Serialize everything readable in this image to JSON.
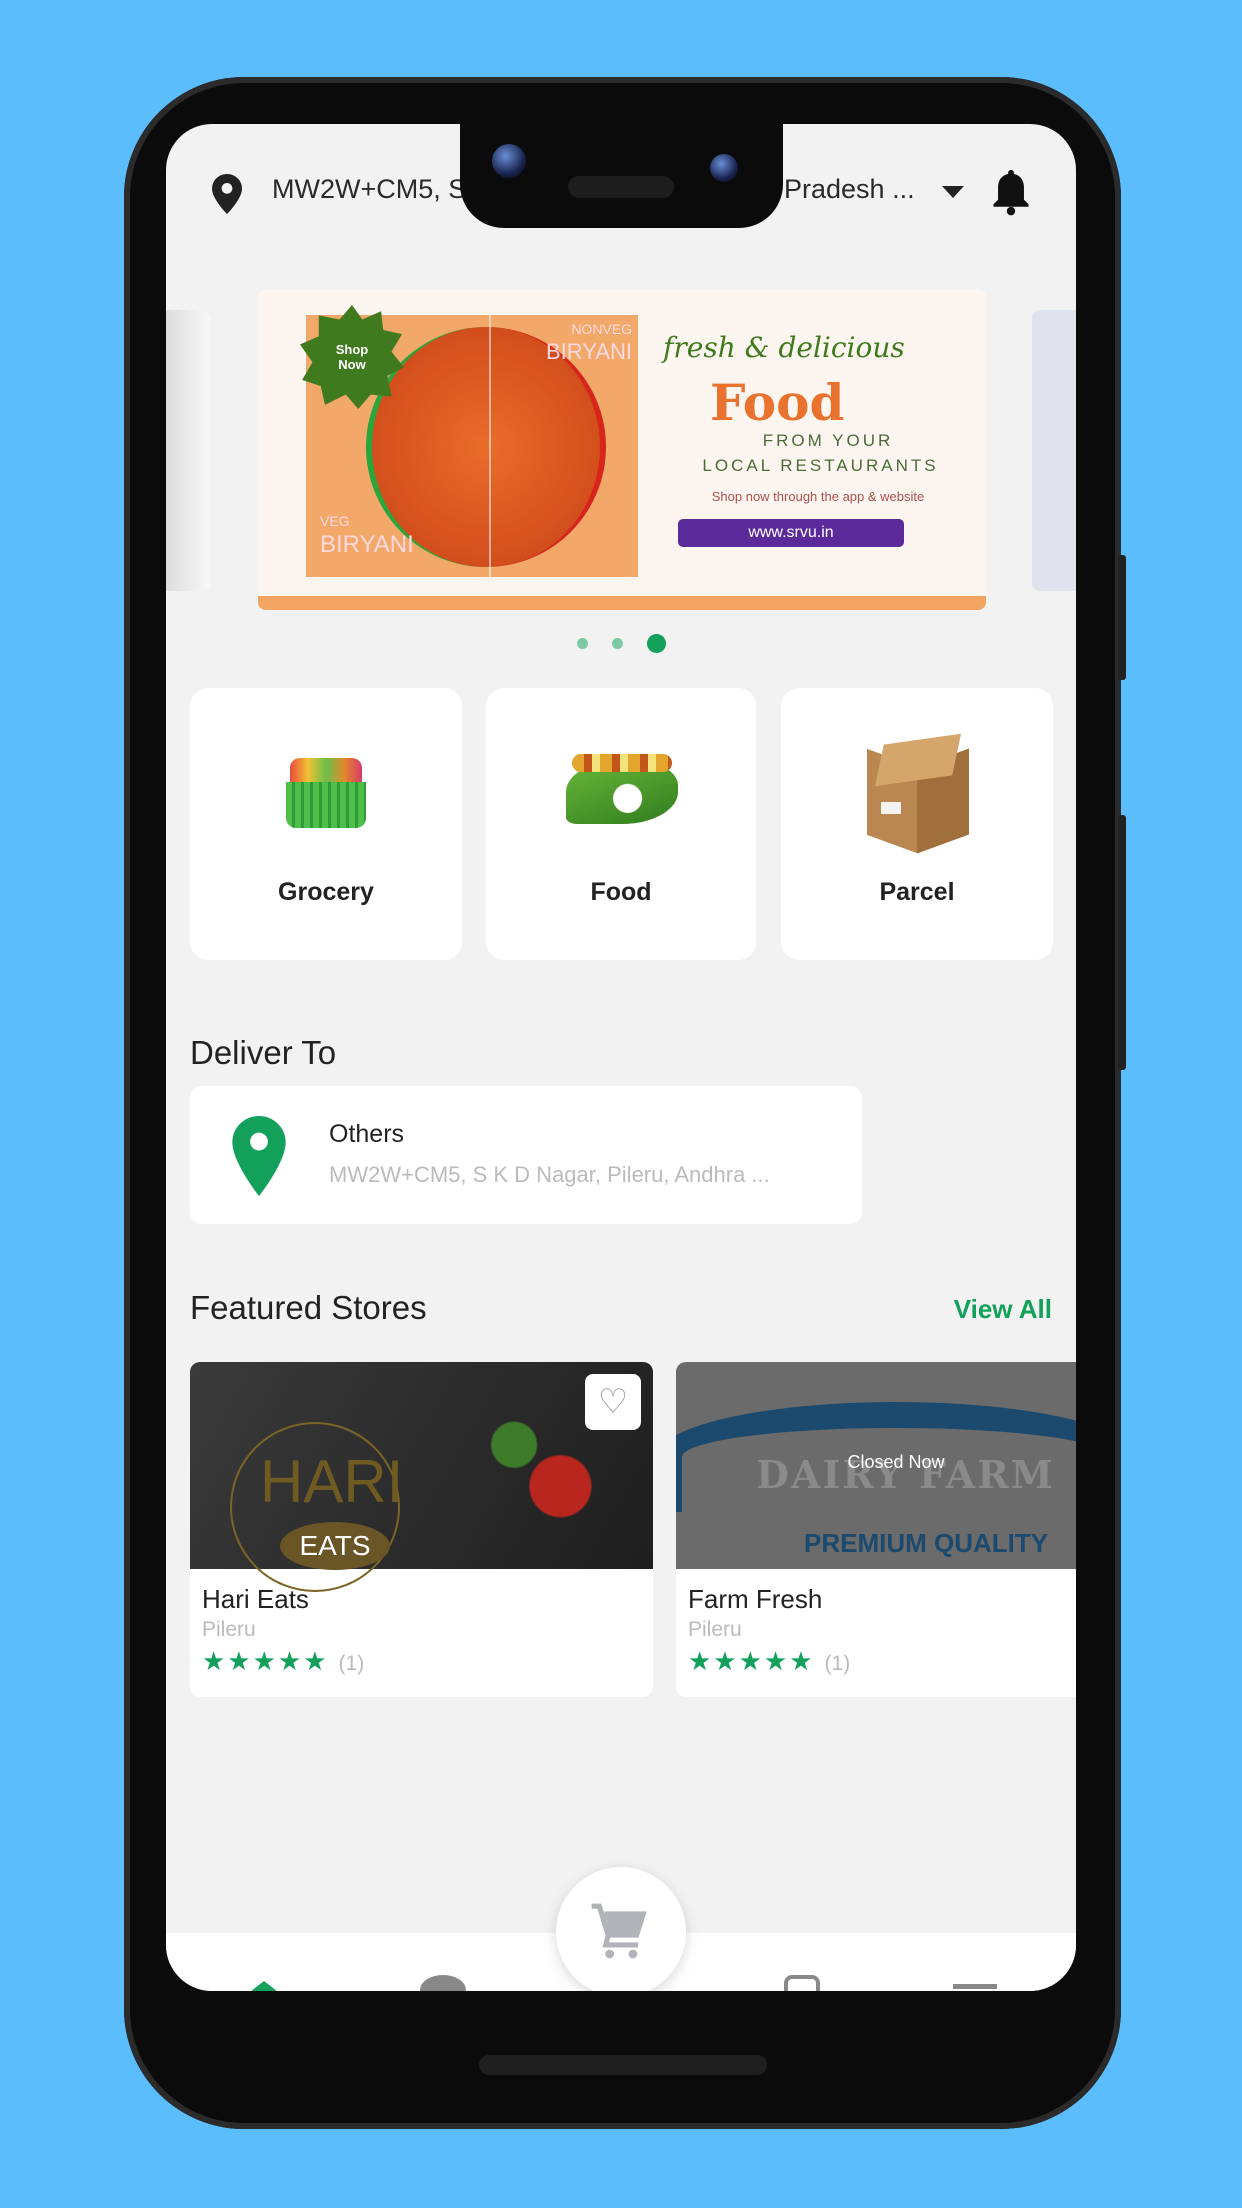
{
  "header": {
    "location_left": "MW2W+CM5, S",
    "location_right": "Pradesh ...",
    "icons": [
      "map-pin-icon",
      "dropdown-triangle-icon",
      "bell-icon"
    ]
  },
  "banner": {
    "badge": "Shop Now",
    "nonveg_label": "NONVEG",
    "nonveg_title": "BIRYANI",
    "veg_label": "VEG",
    "veg_title": "BIRYANI",
    "tagline": "fresh & delicious",
    "headline": "Food",
    "sub1": "FROM YOUR",
    "sub2": "LOCAL RESTAURANTS",
    "note": "Shop now through the app & website",
    "url": "www.srvu.in",
    "active_slide": 3,
    "slide_count": 3
  },
  "categories": [
    {
      "label": "Grocery",
      "icon": "grocery-basket-icon"
    },
    {
      "label": "Food",
      "icon": "food-leaf-icon"
    },
    {
      "label": "Parcel",
      "icon": "parcel-box-icon"
    }
  ],
  "deliver": {
    "heading": "Deliver To",
    "type": "Others",
    "address": "MW2W+CM5, S K D Nagar, Pileru, Andhra ..."
  },
  "featured": {
    "heading": "Featured Stores",
    "view_all": "View All",
    "stores": [
      {
        "name": "Hari Eats",
        "location": "Pileru",
        "rating": 5,
        "stars": "★★★★★",
        "count": "(1)",
        "logo_top": "HARI",
        "logo_bottom": "EATS",
        "status": ""
      },
      {
        "name": "Farm Fresh",
        "location": "Pileru",
        "rating": 5,
        "stars": "★★★★★",
        "count": "(1)",
        "logo_top": "DAIRY FARM",
        "logo_bottom": "PREMIUM QUALITY",
        "status": "Closed Now"
      }
    ]
  },
  "colors": {
    "accent": "#13a05a",
    "background": "#f2f2f2",
    "frame": "#5bbdfb"
  }
}
